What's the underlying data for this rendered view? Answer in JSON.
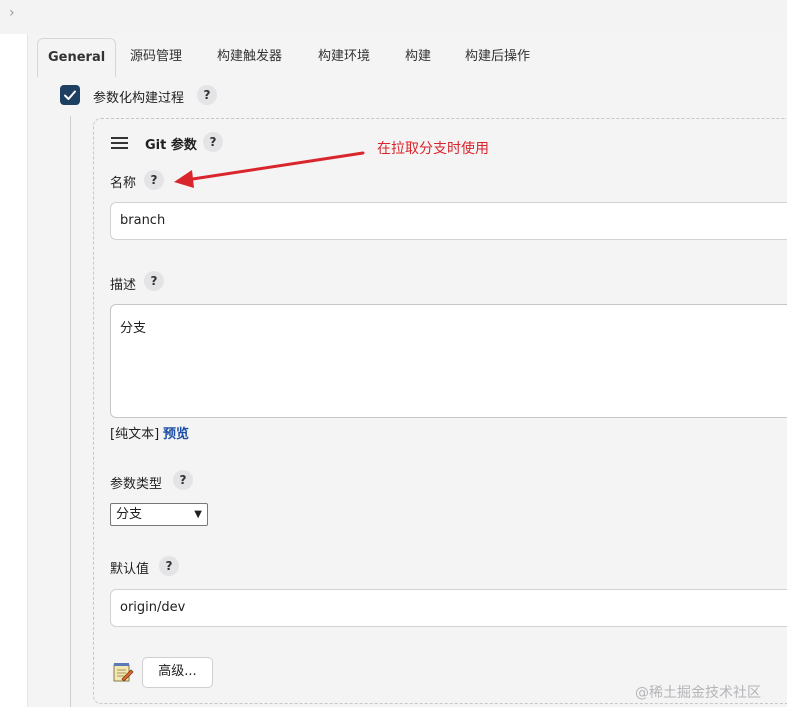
{
  "tabs": [
    {
      "label": "General",
      "active": true
    },
    {
      "label": "源码管理"
    },
    {
      "label": "构建触发器"
    },
    {
      "label": "构建环境"
    },
    {
      "label": "构建"
    },
    {
      "label": "构建后操作"
    }
  ],
  "parameterized": {
    "label": "参数化构建过程",
    "checked": true,
    "help": "?"
  },
  "git_param": {
    "title": "Git 参数",
    "help": "?",
    "name": {
      "label": "名称",
      "help": "?",
      "value": "branch"
    },
    "description": {
      "label": "描述",
      "help": "?",
      "value": "分支",
      "format_prefix": "[纯文本]",
      "preview_link": "预览"
    },
    "type": {
      "label": "参数类型",
      "help": "?",
      "selected": "分支"
    },
    "default": {
      "label": "默认值",
      "help": "?",
      "value": "origin/dev"
    },
    "advanced_button": "高级..."
  },
  "annotation": {
    "text": "在拉取分支时使用",
    "color": "#d9252c"
  },
  "watermark": "@稀土掘金技术社区",
  "colors": {
    "checkbox": "#1d3f62",
    "link": "#1d4ea7",
    "background": "#f4f4f5"
  },
  "icons": {
    "chevron": "chevron-right-icon",
    "handle": "drag-handle-icon",
    "note": "notepad-icon"
  }
}
